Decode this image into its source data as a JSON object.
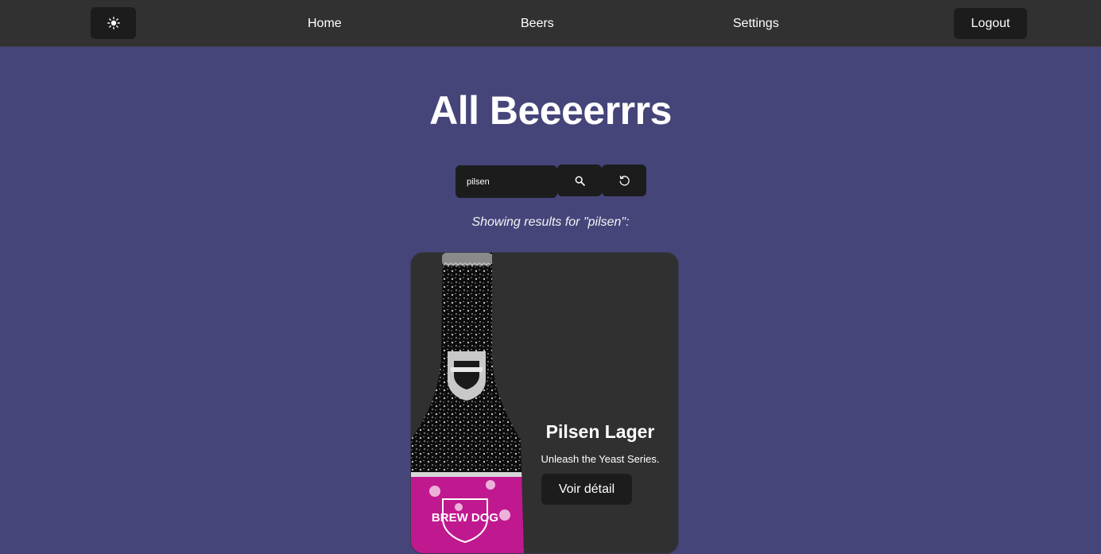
{
  "nav": {
    "theme_icon": "sun-icon",
    "home": "Home",
    "beers": "Beers",
    "settings": "Settings",
    "logout": "Logout"
  },
  "page": {
    "title": "All Beeeerrrs"
  },
  "search": {
    "value": "pilsen",
    "search_icon": "search-icon",
    "reset_icon": "reset-icon"
  },
  "results": {
    "message": "Showing results for \"pilsen\":"
  },
  "beers": [
    {
      "name": "Pilsen Lager",
      "tagline": "Unleash the Yeast Series.",
      "detail_label": "Voir détail",
      "label_text": "BREW DOG"
    }
  ],
  "colors": {
    "background": "#45457a",
    "navbar": "#313131",
    "button": "#1c1c1c",
    "card": "#303030",
    "label_pink": "#c0198f"
  }
}
